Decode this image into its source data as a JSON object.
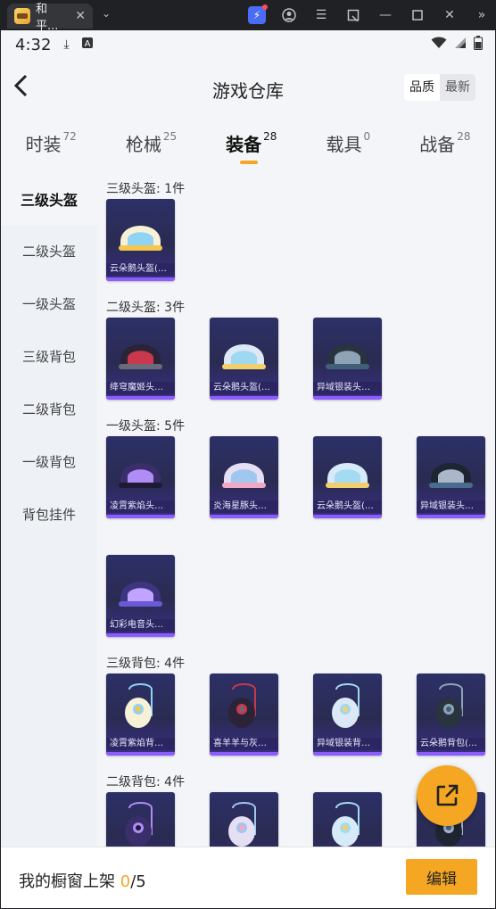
{
  "window": {
    "tab_title": "和平...",
    "tab_close": "✕",
    "dropdown": "⌄",
    "icons": [
      "bolt-icon",
      "profile-icon",
      "menu-icon",
      "screenshot-icon",
      "minimize-icon",
      "maximize-icon",
      "close-icon",
      "more-icon"
    ]
  },
  "status_bar": {
    "time": "4:32",
    "icons": [
      "download-icon",
      "a-icon",
      "wifi-icon",
      "signal-icon",
      "battery-icon"
    ]
  },
  "header": {
    "title": "游戏仓库",
    "sort": {
      "options": [
        "品质",
        "最新"
      ],
      "selected": "品质"
    }
  },
  "categories": [
    {
      "label": "时装",
      "count": "72"
    },
    {
      "label": "枪械",
      "count": "25"
    },
    {
      "label": "装备",
      "count": "28",
      "active": true
    },
    {
      "label": "载具",
      "count": "0"
    },
    {
      "label": "战备",
      "count": "28"
    }
  ],
  "sidebar": [
    {
      "label": "三级头盔",
      "active": true
    },
    {
      "label": "二级头盔"
    },
    {
      "label": "一级头盔"
    },
    {
      "label": "三级背包"
    },
    {
      "label": "二级背包"
    },
    {
      "label": "一级背包"
    },
    {
      "label": "背包挂件"
    }
  ],
  "sections": [
    {
      "title": "三级头盔: 1件",
      "items": [
        "云朵鹅头盔(3..."
      ]
    },
    {
      "title": "二级头盔: 3件",
      "items": [
        "绛穹魔姬头盔...",
        "云朵鹅头盔(2...",
        "异域银装头盔..."
      ]
    },
    {
      "title": "一级头盔: 5件",
      "items": [
        "凌霄紫焰头盔...",
        "炎海星豚头盔...",
        "云朵鹅头盔(1...",
        "异域银装头盔...",
        "幻彩电音头盔..."
      ]
    },
    {
      "title": "三级背包: 4件",
      "items": [
        "凌霄紫焰背包...",
        "喜羊羊与灰太...",
        "异域银装背包...",
        "云朵鹅背包(3..."
      ]
    },
    {
      "title": "二级背包: 4件",
      "items": [
        "",
        "",
        "",
        ""
      ]
    }
  ],
  "bottom": {
    "text_prefix": "我的橱窗上架 ",
    "shelved": "0",
    "total": "/5",
    "edit_label": "编辑"
  },
  "colors": {
    "accent": "#f5a623",
    "card_top": "#2d3067",
    "card_bottom": "#3a2f86",
    "card_stripe": "#8c5cff"
  }
}
